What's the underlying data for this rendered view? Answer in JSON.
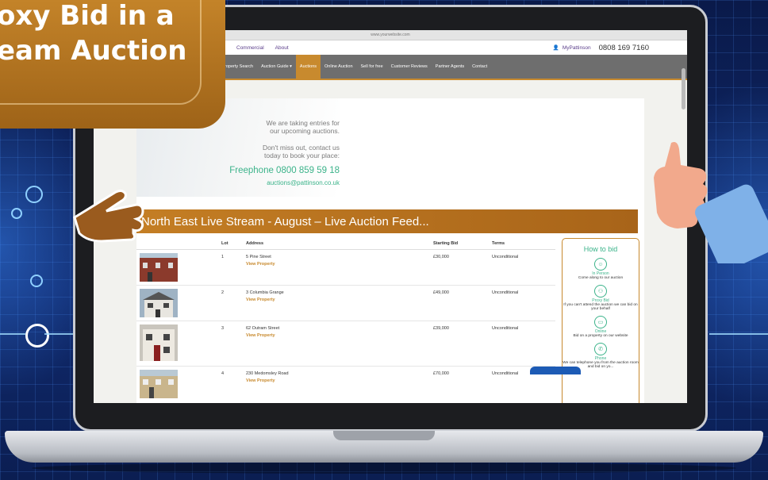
{
  "promo": {
    "line1": "oxy Bid in a",
    "line2": "eam Auction"
  },
  "browser": {
    "url": "www.yourwebsite.com"
  },
  "topnav": {
    "commercial": "Commercial",
    "about": "About",
    "my": "MyPattinson",
    "phone": "0808 169 7160"
  },
  "menu": [
    "roperty Search",
    "Auction Guide ▾",
    "Auctions",
    "Online Auction",
    "Sell for free",
    "Customer Reviews",
    "Partner Agents",
    "Contact"
  ],
  "banner": {
    "l1": "We are taking entries for",
    "l2": "our upcoming auctions.",
    "l3": "Don't miss out, contact us",
    "l4": "today to book your place:",
    "freephone": "Freephone 0800 859 59 18",
    "email": "auctions@pattinson.co.uk"
  },
  "feed": {
    "title": "North East Live Stream - August – Live Auction Feed..."
  },
  "table": {
    "headers": {
      "lot": "Lot",
      "address": "Address",
      "start": "Starting Bid",
      "terms": "Terms"
    },
    "view": "View Property",
    "rows": [
      {
        "lot": "1",
        "address": "5 Pine Street",
        "start": "£30,000",
        "terms": "Unconditional"
      },
      {
        "lot": "2",
        "address": "3 Columbia Grange",
        "start": "£49,000",
        "terms": "Unconditional"
      },
      {
        "lot": "3",
        "address": "62 Outram Street",
        "start": "£39,000",
        "terms": "Unconditional"
      },
      {
        "lot": "4",
        "address": "230 Medomsley Road",
        "start": "£70,000",
        "terms": "Unconditional"
      }
    ]
  },
  "howto": {
    "title": "How to bid",
    "options": [
      {
        "name": "In Person",
        "desc": "Come along to our auction",
        "icon": "person-icon"
      },
      {
        "name": "Proxy Bid",
        "desc": "If you can't attend the auction we can bid on your behalf",
        "icon": "proxy-icon"
      },
      {
        "name": "Online",
        "desc": "Bid on a property on our website",
        "icon": "online-icon"
      },
      {
        "name": "Phone",
        "desc": "We can telephone you from the auction room and bid on yo...",
        "icon": "phone-icon"
      }
    ]
  },
  "colors": {
    "accent": "#c88a2e",
    "green": "#3bb38a",
    "menu": "#6e6e6e"
  }
}
